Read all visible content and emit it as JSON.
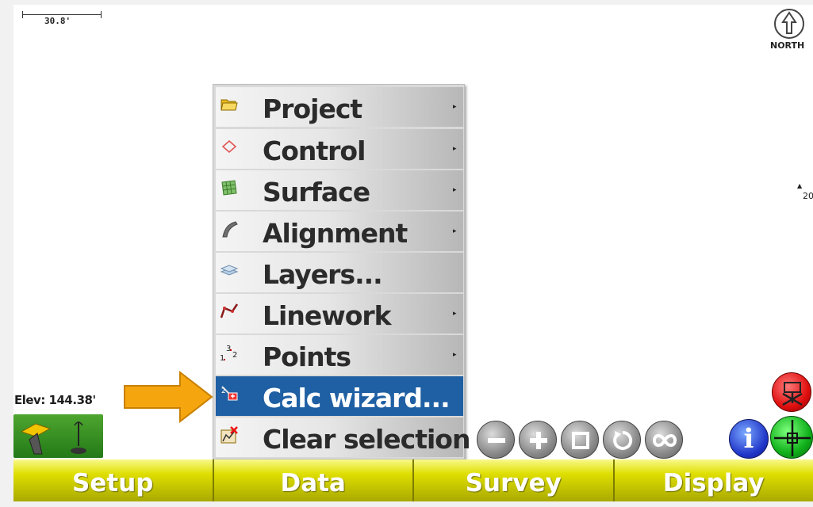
{
  "map": {
    "scale_label": "30.8'",
    "north_label": "NORTH",
    "point_label": "20",
    "elevation": "Elev: 144.38'"
  },
  "menu": {
    "items": [
      {
        "label": "Project",
        "icon": "folder-icon",
        "has_submenu": true
      },
      {
        "label": "Control",
        "icon": "control-diamond-icon",
        "has_submenu": true
      },
      {
        "label": "Surface",
        "icon": "surface-mesh-icon",
        "has_submenu": true
      },
      {
        "label": "Alignment",
        "icon": "alignment-icon",
        "has_submenu": true
      },
      {
        "label": "Layers...",
        "icon": "layers-icon",
        "has_submenu": false
      },
      {
        "label": "Linework",
        "icon": "linework-icon",
        "has_submenu": true
      },
      {
        "label": "Points",
        "icon": "points-icon",
        "has_submenu": true
      },
      {
        "label": "Calc wizard...",
        "icon": "calc-wizard-icon",
        "has_submenu": false,
        "selected": true
      },
      {
        "label": "Clear selection",
        "icon": "clear-selection-icon",
        "has_submenu": false
      }
    ],
    "submenu_glyph": "▸"
  },
  "toolbar": {
    "zoom_buttons": [
      "zoom-out-icon",
      "zoom-in-icon",
      "zoom-extents-icon",
      "zoom-previous-icon",
      "zoom-all-icon"
    ],
    "info_glyph": "i"
  },
  "tabs": {
    "setup": "Setup",
    "data": "Data",
    "survey": "Survey",
    "display": "Display"
  },
  "colors": {
    "selected_menu": "#1f5fa3",
    "tab_yellow": "#dede00",
    "arrow_orange": "#f5a60e"
  }
}
